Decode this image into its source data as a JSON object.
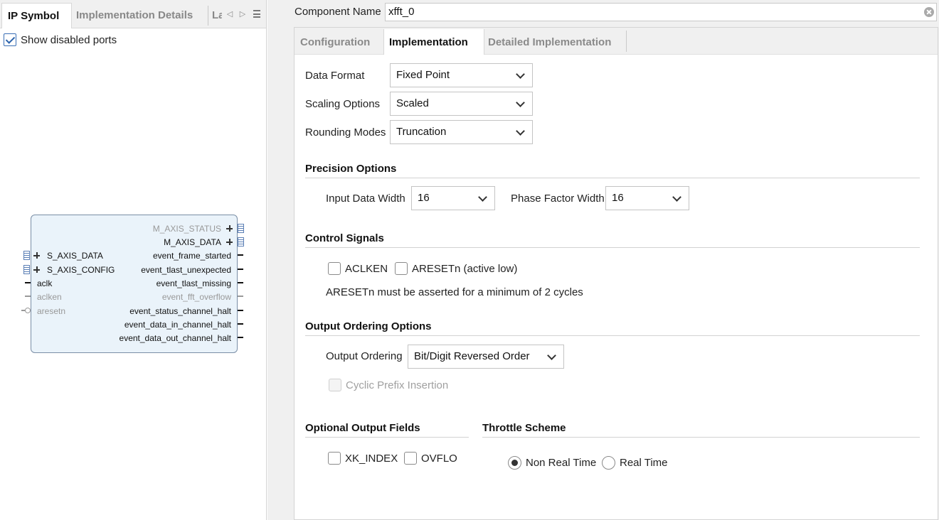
{
  "left_pane": {
    "tabs": [
      "IP Symbol",
      "Implementation Details",
      "La"
    ],
    "show_disabled_ports": {
      "label": "Show disabled ports",
      "checked": true
    },
    "ip_symbol": {
      "outputs": [
        "M_AXIS_STATUS",
        "M_AXIS_DATA",
        "event_frame_started",
        "event_tlast_unexpected",
        "event_tlast_missing",
        "event_fft_overflow",
        "event_status_channel_halt",
        "event_data_in_channel_halt",
        "event_data_out_channel_halt"
      ],
      "inputs": [
        "S_AXIS_DATA",
        "S_AXIS_CONFIG",
        "aclk",
        "aclken",
        "aresetn"
      ]
    }
  },
  "component_name": {
    "label": "Component Name",
    "value": "xfft_0"
  },
  "tabs": [
    "Configuration",
    "Implementation",
    "Detailed Implementation"
  ],
  "active_tab": "Implementation",
  "implementation": {
    "data_format": {
      "label": "Data Format",
      "value": "Fixed Point"
    },
    "scaling_options": {
      "label": "Scaling Options",
      "value": "Scaled"
    },
    "rounding_modes": {
      "label": "Rounding Modes",
      "value": "Truncation"
    },
    "precision": {
      "title": "Precision Options",
      "input_data_width": {
        "label": "Input Data Width",
        "value": "16"
      },
      "phase_factor_width": {
        "label": "Phase Factor Width",
        "value": "16"
      }
    },
    "control_signals": {
      "title": "Control Signals",
      "aclken": {
        "label": "ACLKEN",
        "checked": false
      },
      "aresetn": {
        "label": "ARESETn (active low)",
        "checked": false
      },
      "note": "ARESETn must be asserted for a minimum of 2 cycles"
    },
    "output_ordering": {
      "title": "Output Ordering Options",
      "ordering": {
        "label": "Output Ordering",
        "value": "Bit/Digit Reversed Order"
      },
      "cyclic_prefix": {
        "label": "Cyclic Prefix Insertion",
        "checked": false,
        "enabled": false
      }
    },
    "optional_output_fields": {
      "title": "Optional Output Fields",
      "xk_index": {
        "label": "XK_INDEX",
        "checked": false
      },
      "ovflo": {
        "label": "OVFLO",
        "checked": false
      }
    },
    "throttle_scheme": {
      "title": "Throttle Scheme",
      "options": [
        "Non Real Time",
        "Real Time"
      ],
      "selected": "Non Real Time"
    }
  }
}
